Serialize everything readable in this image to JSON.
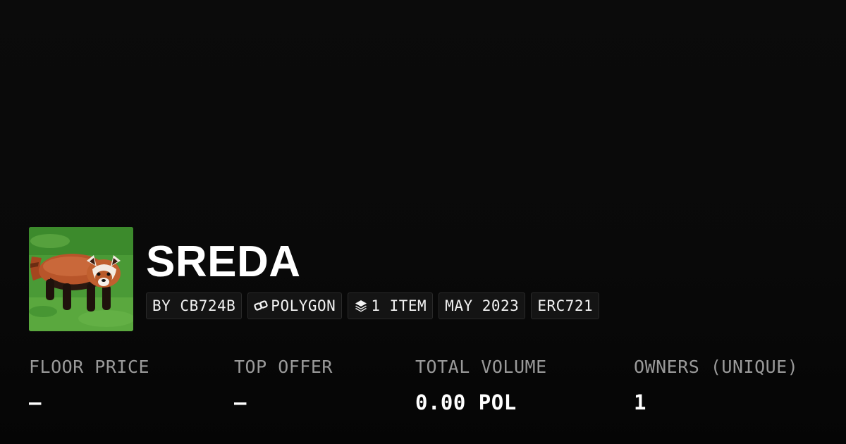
{
  "collection": {
    "name": "SREDA",
    "avatar_icon": "red-panda-photo",
    "badges": {
      "creator": "BY CB724B",
      "chain": "POLYGON",
      "chain_icon": "polygon-link-icon",
      "items": "1 ITEM",
      "items_icon": "layers-icon",
      "date": "MAY 2023",
      "standard": "ERC721"
    }
  },
  "stats": {
    "floor_price": {
      "label": "FLOOR PRICE",
      "value": "—"
    },
    "top_offer": {
      "label": "TOP OFFER",
      "value": "—"
    },
    "total_volume": {
      "label": "TOTAL VOLUME",
      "value": "0.00 POL"
    },
    "owners": {
      "label": "OWNERS (UNIQUE)",
      "value": "1"
    }
  },
  "colors": {
    "background": "#0a0a0a",
    "badge_background": "#141414",
    "badge_border": "#2a2a2a",
    "label_gray": "#9a9a9a",
    "text_white": "#ffffff"
  }
}
